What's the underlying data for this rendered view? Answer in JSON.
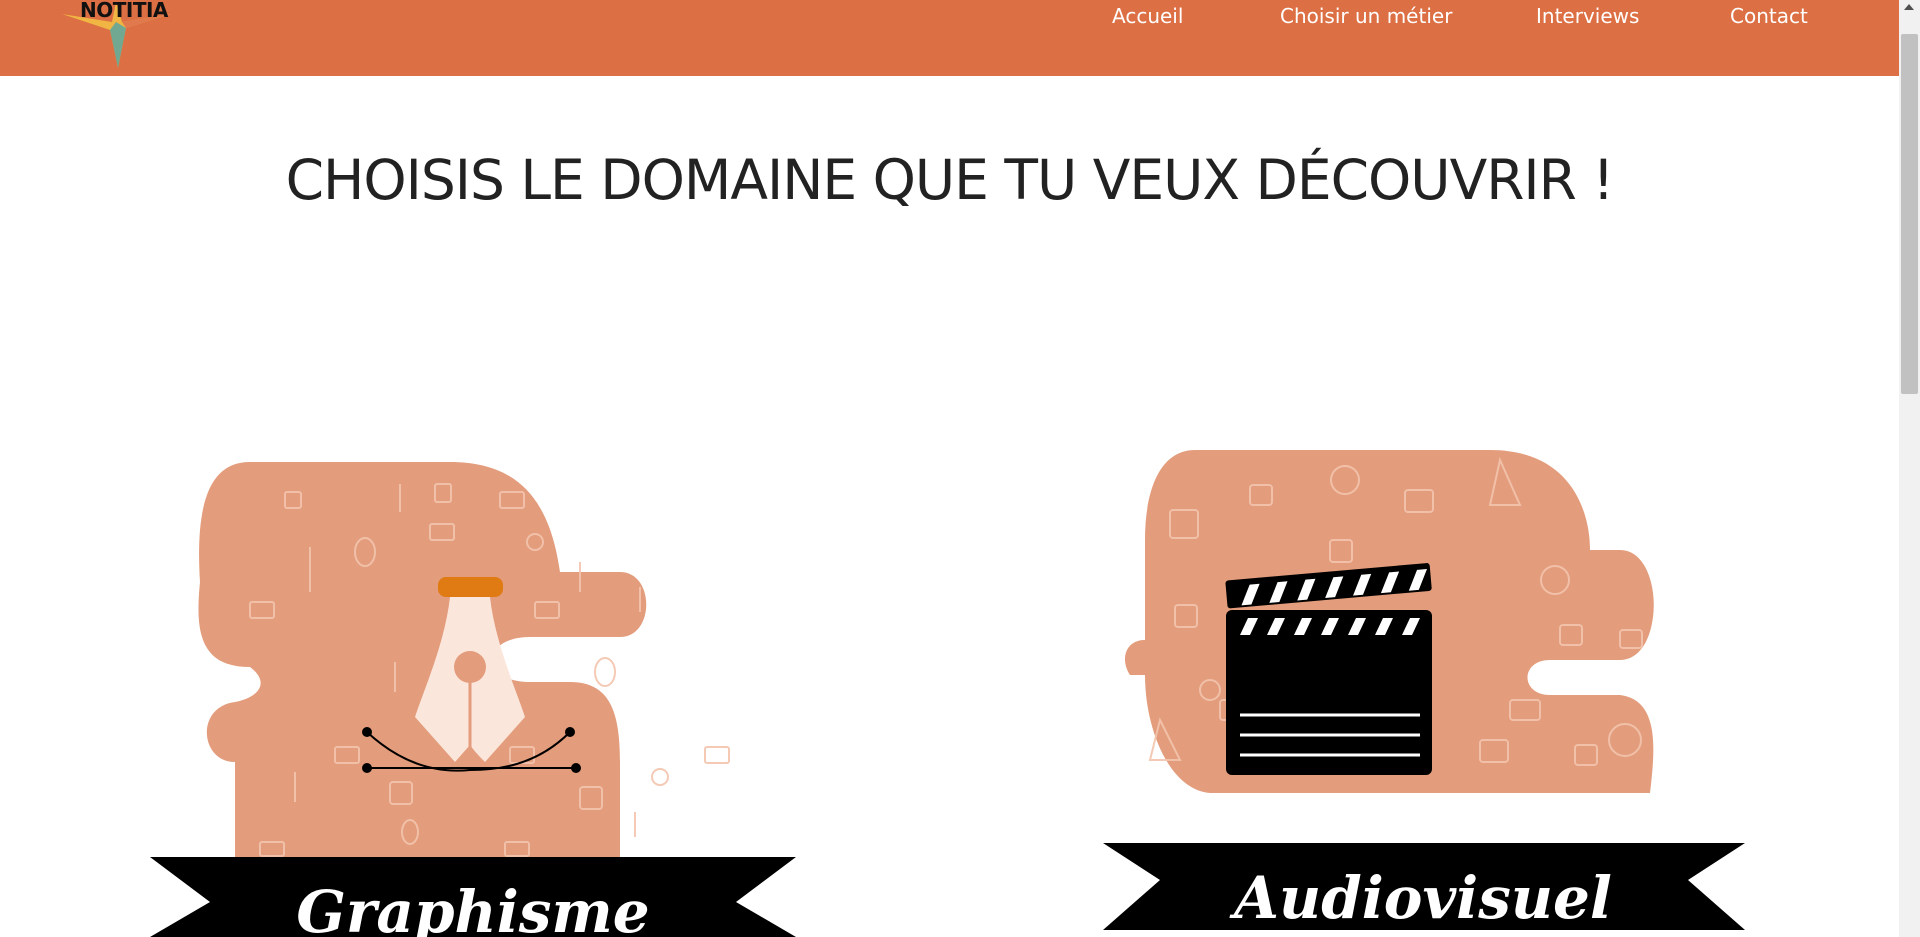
{
  "header": {
    "logo_text": "NOTITIA",
    "nav": [
      {
        "label": "Accueil"
      },
      {
        "label": "Choisir un métier"
      },
      {
        "label": "Interviews"
      },
      {
        "label": "Contact"
      }
    ]
  },
  "main": {
    "title": "CHOISIS LE DOMAINE QUE TU VEUX DÉCOUVRIR !",
    "cards": [
      {
        "label": "Graphisme",
        "icon": "pen-tool-icon"
      },
      {
        "label": "Audiovisuel",
        "icon": "clapperboard-icon"
      }
    ]
  },
  "colors": {
    "header_bg": "#dc6f43",
    "blob": "#e39c7c",
    "banner": "#000000",
    "nav_text": "#ffffff",
    "title_text": "#222222"
  }
}
